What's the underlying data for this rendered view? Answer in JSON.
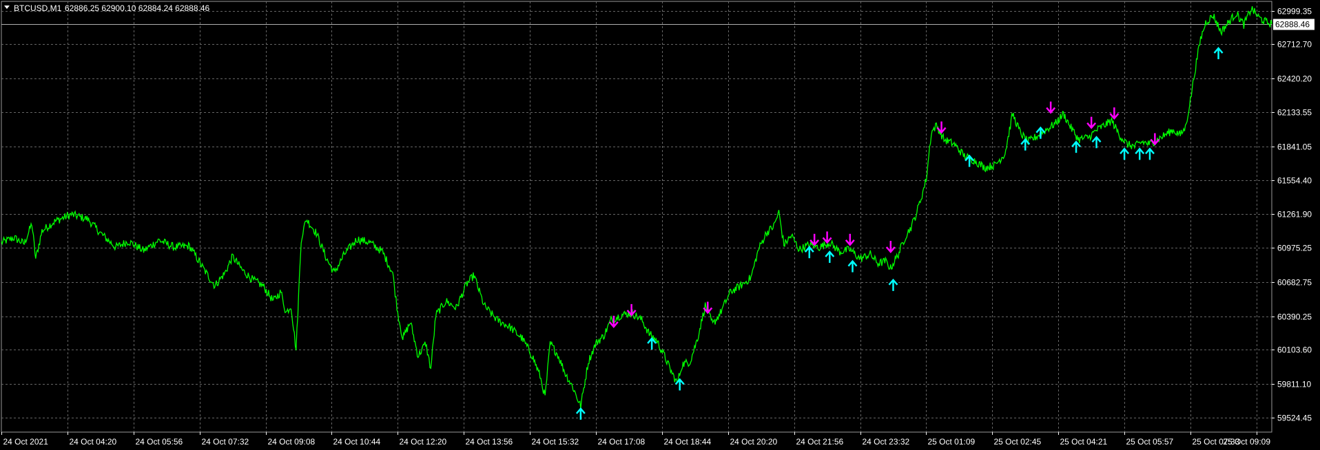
{
  "header": {
    "symbol": "BTCUSD,M1",
    "ohlc": "62886.25 62900.10 62884.24 62888.46"
  },
  "current_price_label": "62888.46",
  "colors": {
    "background": "#000000",
    "grid": "#666666",
    "line": "#00ff00",
    "buy_arrow": "#00ffff",
    "sell_arrow": "#ff00ff",
    "text": "#ffffff"
  },
  "chart_data": {
    "type": "line",
    "title": "BTCUSD,M1",
    "xlabel": "",
    "ylabel": "",
    "ylim": [
      59400,
      63080
    ],
    "xlim": [
      0,
      1000
    ],
    "grid": true,
    "y_ticks": [
      {
        "value": 62999.35,
        "label": "62999.35"
      },
      {
        "value": 62712.7,
        "label": "62712.70"
      },
      {
        "value": 62420.2,
        "label": "62420.20"
      },
      {
        "value": 62133.55,
        "label": "62133.55"
      },
      {
        "value": 61841.05,
        "label": "61841.05"
      },
      {
        "value": 61554.4,
        "label": "61554.40"
      },
      {
        "value": 61261.9,
        "label": "61261.90"
      },
      {
        "value": 60975.25,
        "label": "60975.25"
      },
      {
        "value": 60682.75,
        "label": "60682.75"
      },
      {
        "value": 60390.25,
        "label": "60390.25"
      },
      {
        "value": 60103.6,
        "label": "60103.60"
      },
      {
        "value": 59811.1,
        "label": "59811.10"
      },
      {
        "value": 59524.45,
        "label": "59524.45"
      }
    ],
    "x_ticks": [
      {
        "value": 0,
        "label": "24 Oct 2021"
      },
      {
        "value": 52,
        "label": "24 Oct 04:20"
      },
      {
        "value": 104,
        "label": "24 Oct 05:56"
      },
      {
        "value": 156,
        "label": "24 Oct 07:32"
      },
      {
        "value": 208,
        "label": "24 Oct 09:08"
      },
      {
        "value": 260,
        "label": "24 Oct 10:44"
      },
      {
        "value": 312,
        "label": "24 Oct 12:20"
      },
      {
        "value": 364,
        "label": "24 Oct 13:56"
      },
      {
        "value": 416,
        "label": "24 Oct 15:32"
      },
      {
        "value": 468,
        "label": "24 Oct 17:08"
      },
      {
        "value": 520,
        "label": "24 Oct 18:44"
      },
      {
        "value": 572,
        "label": "24 Oct 20:20"
      },
      {
        "value": 624,
        "label": "24 Oct 21:56"
      },
      {
        "value": 676,
        "label": "24 Oct 23:32"
      },
      {
        "value": 728,
        "label": "25 Oct 01:09"
      },
      {
        "value": 780,
        "label": "25 Oct 02:45"
      },
      {
        "value": 832,
        "label": "25 Oct 04:21"
      },
      {
        "value": 884,
        "label": "25 Oct 05:57"
      },
      {
        "value": 936,
        "label": "25 Oct 07:33"
      },
      {
        "value": 988,
        "label": "25 Oct 09:09"
      }
    ],
    "current_price": 62888.46,
    "series": [
      {
        "points": [
          [
            0,
            61020
          ],
          [
            10,
            61060
          ],
          [
            18,
            61010
          ],
          [
            24,
            61180
          ],
          [
            27,
            60880
          ],
          [
            32,
            61120
          ],
          [
            42,
            61200
          ],
          [
            55,
            61260
          ],
          [
            68,
            61220
          ],
          [
            78,
            61100
          ],
          [
            90,
            60980
          ],
          [
            100,
            61030
          ],
          [
            112,
            60950
          ],
          [
            124,
            61040
          ],
          [
            136,
            60980
          ],
          [
            148,
            60990
          ],
          [
            160,
            60780
          ],
          [
            168,
            60650
          ],
          [
            176,
            60760
          ],
          [
            182,
            60900
          ],
          [
            190,
            60780
          ],
          [
            198,
            60700
          ],
          [
            206,
            60650
          ],
          [
            214,
            60520
          ],
          [
            220,
            60600
          ],
          [
            224,
            60420
          ],
          [
            228,
            60480
          ],
          [
            232,
            60100
          ],
          [
            236,
            61050
          ],
          [
            240,
            61220
          ],
          [
            248,
            61100
          ],
          [
            256,
            60880
          ],
          [
            262,
            60760
          ],
          [
            270,
            60920
          ],
          [
            280,
            61050
          ],
          [
            290,
            61020
          ],
          [
            300,
            60940
          ],
          [
            308,
            60760
          ],
          [
            312,
            60420
          ],
          [
            316,
            60200
          ],
          [
            322,
            60340
          ],
          [
            328,
            60050
          ],
          [
            334,
            60160
          ],
          [
            338,
            59940
          ],
          [
            342,
            60400
          ],
          [
            350,
            60520
          ],
          [
            358,
            60460
          ],
          [
            366,
            60660
          ],
          [
            372,
            60740
          ],
          [
            380,
            60480
          ],
          [
            390,
            60360
          ],
          [
            400,
            60300
          ],
          [
            410,
            60200
          ],
          [
            418,
            60050
          ],
          [
            424,
            59880
          ],
          [
            428,
            59700
          ],
          [
            432,
            60160
          ],
          [
            438,
            60060
          ],
          [
            444,
            59900
          ],
          [
            450,
            59780
          ],
          [
            456,
            59620
          ],
          [
            462,
            60000
          ],
          [
            468,
            60160
          ],
          [
            474,
            60220
          ],
          [
            480,
            60360
          ],
          [
            488,
            60400
          ],
          [
            496,
            60420
          ],
          [
            504,
            60360
          ],
          [
            510,
            60240
          ],
          [
            516,
            60180
          ],
          [
            522,
            60050
          ],
          [
            528,
            59900
          ],
          [
            532,
            59820
          ],
          [
            536,
            59980
          ],
          [
            542,
            60000
          ],
          [
            548,
            60200
          ],
          [
            554,
            60480
          ],
          [
            560,
            60320
          ],
          [
            566,
            60420
          ],
          [
            574,
            60600
          ],
          [
            582,
            60650
          ],
          [
            590,
            60720
          ],
          [
            596,
            60960
          ],
          [
            602,
            61100
          ],
          [
            608,
            61160
          ],
          [
            612,
            61280
          ],
          [
            616,
            61000
          ],
          [
            622,
            61080
          ],
          [
            628,
            60960
          ],
          [
            636,
            61000
          ],
          [
            644,
            60980
          ],
          [
            652,
            61020
          ],
          [
            660,
            60940
          ],
          [
            668,
            60960
          ],
          [
            676,
            60880
          ],
          [
            684,
            60920
          ],
          [
            690,
            60840
          ],
          [
            696,
            60860
          ],
          [
            700,
            60800
          ],
          [
            706,
            60920
          ],
          [
            712,
            61080
          ],
          [
            716,
            61150
          ],
          [
            720,
            61260
          ],
          [
            724,
            61400
          ],
          [
            728,
            61560
          ],
          [
            732,
            61960
          ],
          [
            736,
            62020
          ],
          [
            742,
            61900
          ],
          [
            750,
            61860
          ],
          [
            758,
            61760
          ],
          [
            766,
            61720
          ],
          [
            774,
            61660
          ],
          [
            782,
            61680
          ],
          [
            790,
            61780
          ],
          [
            796,
            62120
          ],
          [
            802,
            61960
          ],
          [
            808,
            61880
          ],
          [
            814,
            61920
          ],
          [
            822,
            61980
          ],
          [
            830,
            62040
          ],
          [
            836,
            62120
          ],
          [
            842,
            62000
          ],
          [
            848,
            61900
          ],
          [
            856,
            61920
          ],
          [
            862,
            61980
          ],
          [
            868,
            62020
          ],
          [
            874,
            62060
          ],
          [
            880,
            61940
          ],
          [
            886,
            61860
          ],
          [
            892,
            61840
          ],
          [
            898,
            61880
          ],
          [
            904,
            61860
          ],
          [
            910,
            61900
          ],
          [
            916,
            61940
          ],
          [
            922,
            61980
          ],
          [
            928,
            61940
          ],
          [
            932,
            62000
          ],
          [
            936,
            62240
          ],
          [
            940,
            62520
          ],
          [
            944,
            62760
          ],
          [
            948,
            62900
          ],
          [
            954,
            62960
          ],
          [
            960,
            62820
          ],
          [
            966,
            62900
          ],
          [
            972,
            62980
          ],
          [
            978,
            62880
          ],
          [
            984,
            63020
          ],
          [
            990,
            62940
          ],
          [
            996,
            62900
          ],
          [
            1000,
            62888
          ]
        ]
      }
    ],
    "buy_arrows": [
      [
        456,
        59600
      ],
      [
        512,
        60200
      ],
      [
        534,
        59850
      ],
      [
        762,
        61760
      ],
      [
        806,
        61900
      ],
      [
        818,
        62000
      ],
      [
        846,
        61880
      ],
      [
        862,
        61920
      ],
      [
        702,
        60700
      ],
      [
        636,
        60980
      ],
      [
        652,
        60940
      ],
      [
        670,
        60860
      ],
      [
        884,
        61820
      ],
      [
        896,
        61820
      ],
      [
        904,
        61820
      ],
      [
        958,
        62680
      ]
    ],
    "sell_arrows": [
      [
        482,
        60300
      ],
      [
        496,
        60400
      ],
      [
        556,
        60420
      ],
      [
        740,
        61960
      ],
      [
        826,
        62130
      ],
      [
        858,
        62000
      ],
      [
        876,
        62080
      ],
      [
        640,
        61000
      ],
      [
        650,
        61020
      ],
      [
        668,
        61000
      ],
      [
        700,
        60940
      ],
      [
        908,
        61860
      ]
    ]
  }
}
